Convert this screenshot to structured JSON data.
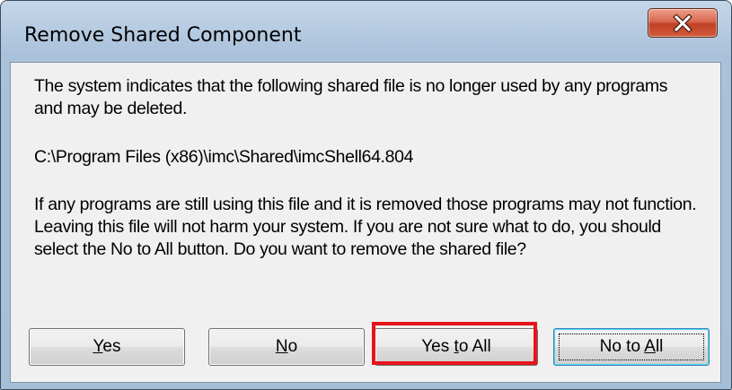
{
  "window": {
    "title": "Remove Shared Component"
  },
  "icons": {
    "close": "close-icon"
  },
  "message": {
    "line1": "The system indicates that the following shared file is no longer used by any programs and may be deleted.",
    "file_path": "C:\\Program Files (x86)\\imc\\Shared\\imcShell64.804",
    "line2": "If any programs are still using this file and it is removed those programs may not function. Leaving this file will not harm your system. If you are not sure what to do, you should select the No to All button. Do you want to remove the shared file?"
  },
  "buttons": {
    "yes": {
      "label": "Yes",
      "mnemonic": "Y",
      "rest": "es"
    },
    "no": {
      "label": "No",
      "mnemonic": "N",
      "rest": "o"
    },
    "yes_to_all": {
      "label": "Yes to All",
      "prefix": "Yes ",
      "mnemonic": "t",
      "rest": "o All"
    },
    "no_to_all": {
      "label": "No to All",
      "prefix": "No to ",
      "mnemonic": "A",
      "rest": "ll"
    }
  },
  "colors": {
    "highlight": "#e8141c",
    "close_button": "#c04025"
  }
}
